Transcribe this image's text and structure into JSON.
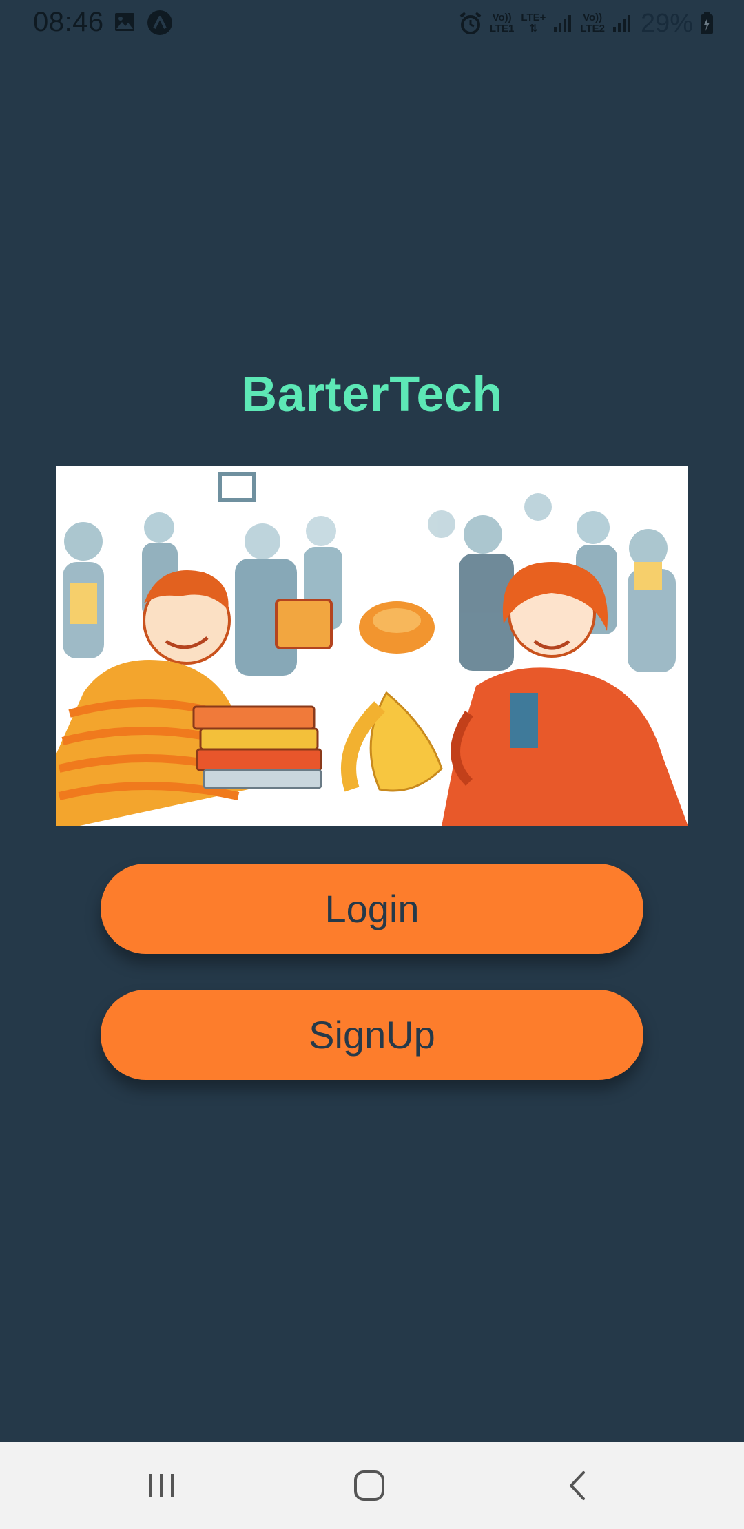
{
  "status_bar": {
    "time": "08:46",
    "sim1_top": "Vo))",
    "sim1_bottom": "LTE1",
    "sim1_tech": "LTE+",
    "sim2_top": "Vo))",
    "sim2_bottom": "LTE2",
    "battery": "29%",
    "icons": [
      "gallery-icon",
      "app-notification-icon",
      "alarm-icon",
      "signal-icon",
      "battery-icon"
    ]
  },
  "app": {
    "title": "BarterTech",
    "hero_image_alt": "barter-illustration"
  },
  "buttons": {
    "login": "Login",
    "signup": "SignUp"
  },
  "colors": {
    "background": "#253949",
    "title": "#5de8b6",
    "button": "#fd7d2c",
    "button_text": "#253949",
    "nav_bar": "#f2f2f2"
  },
  "nav_bar": {
    "icons": [
      "recents-icon",
      "home-icon",
      "back-icon"
    ]
  }
}
